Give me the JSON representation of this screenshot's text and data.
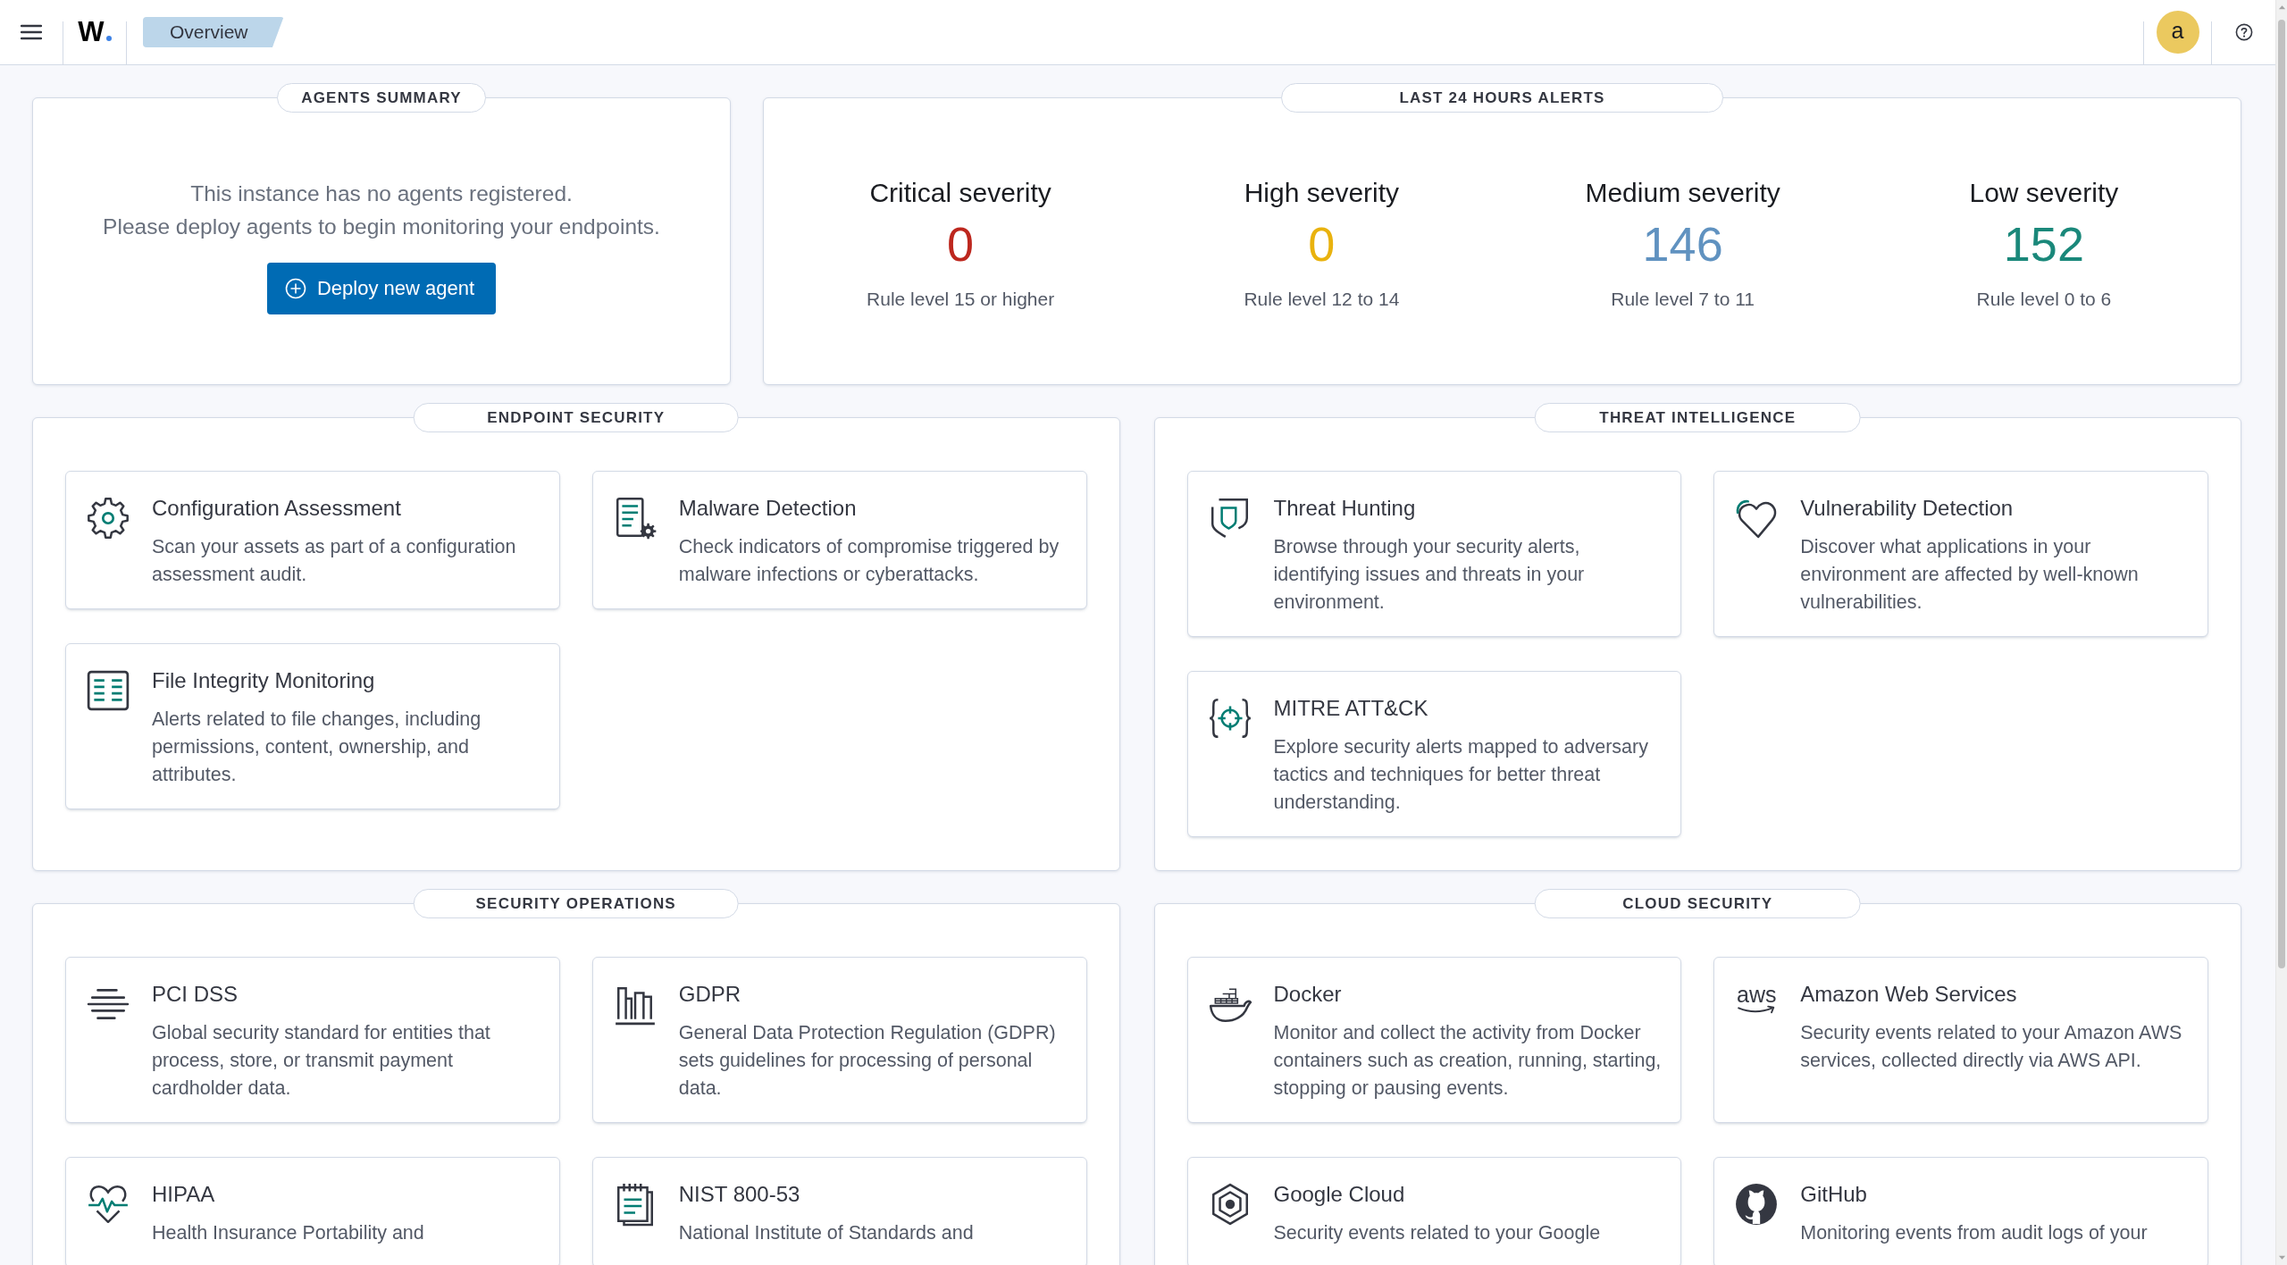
{
  "topbar": {
    "logo": "W",
    "breadcrumb": "Overview",
    "avatar": "a"
  },
  "agents_summary": {
    "title": "AGENTS SUMMARY",
    "messages": [
      "This instance has no agents registered.",
      "Please deploy agents to begin monitoring your endpoints."
    ],
    "button": "Deploy new agent"
  },
  "alerts": {
    "title": "LAST 24 HOURS ALERTS",
    "columns": [
      {
        "label": "Critical severity",
        "count": "0",
        "color": "#bd271e",
        "range": "Rule level 15 or higher"
      },
      {
        "label": "High severity",
        "count": "0",
        "color": "#e9b20e",
        "range": "Rule level 12 to 14"
      },
      {
        "label": "Medium severity",
        "count": "146",
        "color": "#6092c0",
        "range": "Rule level 7 to 11"
      },
      {
        "label": "Low severity",
        "count": "152",
        "color": "#1a887a",
        "range": "Rule level 0 to 6"
      }
    ]
  },
  "sections": [
    {
      "title": "ENDPOINT SECURITY",
      "cards": [
        {
          "title": "Configuration Assessment",
          "description": "Scan your assets as part of a configuration assessment audit."
        },
        {
          "title": "Malware Detection",
          "description": "Check indicators of compromise triggered by malware infections or cyberattacks."
        },
        {
          "title": "File Integrity Monitoring",
          "description": "Alerts related to file changes, including permissions, content, ownership, and attributes."
        }
      ]
    },
    {
      "title": "THREAT INTELLIGENCE",
      "cards": [
        {
          "title": "Threat Hunting",
          "description": "Browse through your security alerts, identifying issues and threats in your environment."
        },
        {
          "title": "Vulnerability Detection",
          "description": "Discover what applications in your environment are affected by well-known vulnerabilities."
        },
        {
          "title": "MITRE ATT&CK",
          "description": "Explore security alerts mapped to adversary tactics and techniques for better threat understanding."
        }
      ]
    },
    {
      "title": "SECURITY OPERATIONS",
      "cards": [
        {
          "title": "PCI DSS",
          "description": "Global security standard for entities that process, store, or transmit payment cardholder data."
        },
        {
          "title": "GDPR",
          "description": "General Data Protection Regulation (GDPR) sets guidelines for processing of personal data."
        },
        {
          "title": "HIPAA",
          "description": "Health Insurance Portability and"
        },
        {
          "title": "NIST 800-53",
          "description": "National Institute of Standards and"
        }
      ]
    },
    {
      "title": "CLOUD SECURITY",
      "cards": [
        {
          "title": "Docker",
          "description": "Monitor and collect the activity from Docker containers such as creation, running, starting, stopping or pausing events."
        },
        {
          "title": "Amazon Web Services",
          "logo_text": "aws",
          "description": "Security events related to your Amazon AWS services, collected directly via AWS API."
        },
        {
          "title": "Google Cloud",
          "description": "Security events related to your Google"
        },
        {
          "title": "GitHub",
          "description": "Monitoring events from audit logs of your"
        }
      ]
    }
  ]
}
